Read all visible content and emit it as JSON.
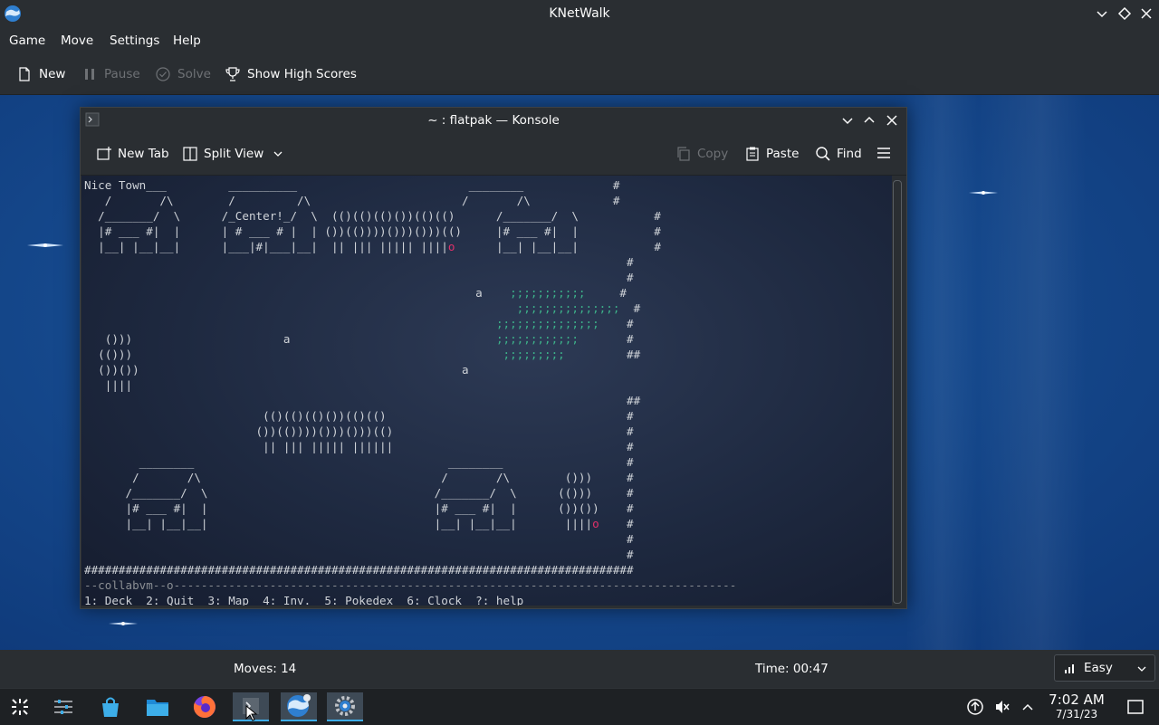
{
  "window": {
    "title": "KNetWalk"
  },
  "menu": [
    "Game",
    "Move",
    "Settings",
    "Help"
  ],
  "toolbar": {
    "new": "New",
    "pause": "Pause",
    "solve": "Solve",
    "high_scores": "Show High Scores"
  },
  "konsole": {
    "title": "~ : flatpak — Konsole",
    "new_tab": "New Tab",
    "split_view": "Split View",
    "copy": "Copy",
    "paste": "Paste",
    "find": "Find"
  },
  "terminal": {
    "footer_label": "--collabvm--o",
    "help_line": "1: Deck  2: Quit  3: Map  4: Inv.  5: Pokedex  6: Clock  ?: help"
  },
  "status": {
    "moves": "Moves: 14",
    "time": "Time: 00:47",
    "difficulty": "Easy"
  },
  "clock": {
    "time": "7:02 AM",
    "date": "7/31/23"
  },
  "colors": {
    "panel": "#2a2e32",
    "accent": "#3daee9",
    "desktop_blue": "#164a8e",
    "terminal_green": "#3db38a",
    "terminal_red": "#e0306a"
  }
}
